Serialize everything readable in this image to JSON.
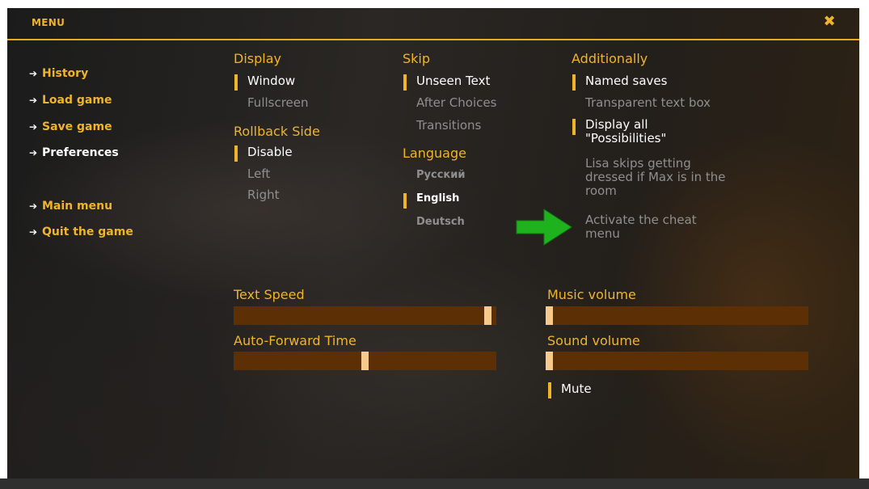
{
  "header": {
    "title": "MENU",
    "close_icon": "close-x-icon"
  },
  "nav": {
    "items": [
      {
        "label": "History",
        "active": false
      },
      {
        "label": "Load game",
        "active": false
      },
      {
        "label": "Save game",
        "active": false
      },
      {
        "label": "Preferences",
        "active": true
      },
      {
        "label": "Main menu",
        "active": false
      },
      {
        "label": "Quit the game",
        "active": false
      }
    ]
  },
  "display": {
    "title": "Display",
    "options": [
      "Window",
      "Fullscreen"
    ],
    "selected": "Window"
  },
  "rollback": {
    "title": "Rollback Side",
    "options": [
      "Disable",
      "Left",
      "Right"
    ],
    "selected": "Disable"
  },
  "skip": {
    "title": "Skip",
    "options": [
      "Unseen Text",
      "After Choices",
      "Transitions"
    ],
    "selected": "Unseen Text"
  },
  "language": {
    "title": "Language",
    "options": [
      "Русский",
      "English",
      "Deutsch"
    ],
    "selected": "English"
  },
  "additionally": {
    "title": "Additionally",
    "options": [
      {
        "label": "Named saves",
        "selected": true
      },
      {
        "label": "Transparent text box",
        "selected": false
      },
      {
        "label": "Display all \"Possibilities\"",
        "selected": true
      },
      {
        "label": "Lisa skips getting dressed if Max is in the room",
        "selected": false
      },
      {
        "label": "Activate the cheat menu",
        "selected": false
      }
    ]
  },
  "sliders": {
    "text_speed": {
      "label": "Text Speed",
      "value": 0.98
    },
    "auto_forward": {
      "label": "Auto-Forward Time",
      "value": 0.5
    },
    "music_volume": {
      "label": "Music volume",
      "value": 0.0
    },
    "sound_volume": {
      "label": "Sound volume",
      "value": 0.0
    }
  },
  "mute": {
    "label": "Mute",
    "selected": true
  },
  "colors": {
    "accent": "#f0b429",
    "bar_track": "#5c2f05",
    "bar_thumb": "#f7c98a",
    "selected_text": "#ffffff",
    "unselected_text": "#8f8f8f",
    "pointer_arrow": "#1fb21f"
  },
  "icons": {
    "nav_arrow": "chevron-right-icon",
    "pointer": "green-arrow-icon"
  }
}
